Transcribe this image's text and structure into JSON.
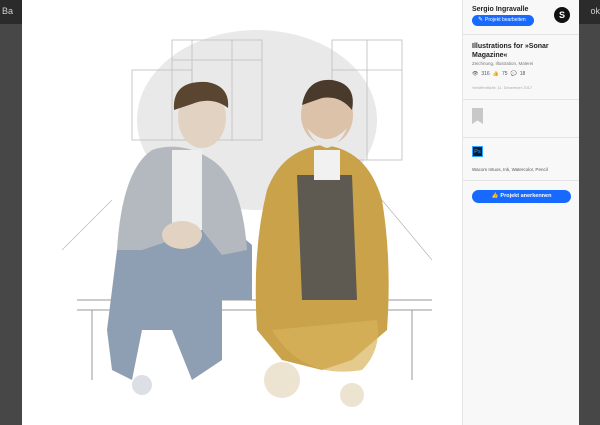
{
  "edge": {
    "left_text": "Ba",
    "right_text": "ok"
  },
  "owner": {
    "name": "Sergio Ingravalle",
    "edit_label": "Projekt bearbeiten",
    "logo_letter": "S"
  },
  "project": {
    "title": "Illustrations for »Sonar Magazine«",
    "fields": "Zeichnung, Illustration, Malerei",
    "views": "316",
    "appreciations": "75",
    "comments": "18",
    "published": "Veröffentlicht: 11. Dezember 2017"
  },
  "tools": {
    "ps_label": "Ps",
    "text": "Wacom Intuos, Ink, Watercolor, Pencil"
  },
  "appreciate": {
    "label": "Projekt anerkennen"
  },
  "colors": {
    "accent": "#1769ff",
    "overlay": "#474747"
  },
  "icons": [
    "eye-icon",
    "thumbs-up-icon",
    "comment-icon",
    "pencil-icon",
    "badge-icon",
    "photoshop-icon"
  ]
}
